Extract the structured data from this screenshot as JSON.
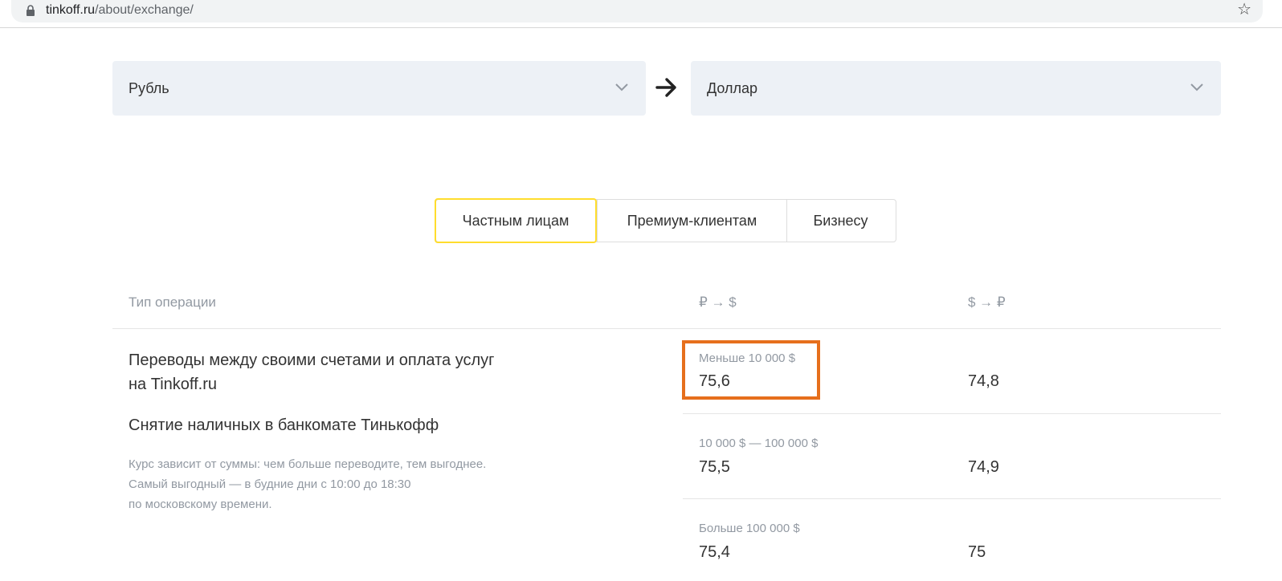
{
  "browser": {
    "url_host": "tinkoff.ru",
    "url_path": "/about/exchange/"
  },
  "converter": {
    "from_currency": "Рубль",
    "to_currency": "Доллар"
  },
  "tabs": [
    {
      "label": "Частным лицам",
      "active": true
    },
    {
      "label": "Премиум-клиентам",
      "active": false
    },
    {
      "label": "Бизнесу",
      "active": false
    }
  ],
  "table": {
    "headers": {
      "operation": "Тип операции",
      "rub_to_usd": "₽ → $",
      "usd_to_rub": "$ → ₽"
    },
    "operations": [
      "Переводы между своими счетами и оплата услуг на Tinkoff.ru",
      "Снятие наличных в банкомате Тинькофф"
    ],
    "note_lines": [
      "Курс зависит от суммы: чем больше переводите, тем выгоднее.",
      "Самый выгодный — в будние дни с 10:00 до 18:30",
      "по московскому времени."
    ],
    "tiers": [
      {
        "label": "Меньше 10 000 $",
        "buy": "75,6",
        "sell": "74,8"
      },
      {
        "label": "10 000 $ — 100 000 $",
        "buy": "75,5",
        "sell": "74,9"
      },
      {
        "label": "Больше 100 000 $",
        "buy": "75,4",
        "sell": "75"
      }
    ]
  },
  "colors": {
    "active_tab_border": "#ffdd2d",
    "highlight_box": "#e66f1c",
    "select_bg": "#edf1f6"
  }
}
